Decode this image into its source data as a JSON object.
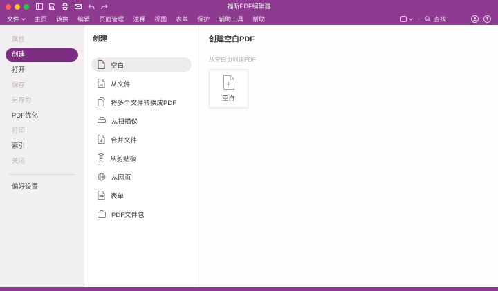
{
  "colors": {
    "titlebar": "#8e3a91",
    "accent": "#7d2d82",
    "sidebar_bg": "#f1eff1",
    "selected_pill": "#ececec"
  },
  "titlebar": {
    "title": "福昕PDF编辑器"
  },
  "menubar": {
    "items": [
      {
        "label": "文件",
        "state": "active-with-caret"
      },
      {
        "label": "主页"
      },
      {
        "label": "转换"
      },
      {
        "label": "编辑"
      },
      {
        "label": "页面管理"
      },
      {
        "label": "注释"
      },
      {
        "label": "视图"
      },
      {
        "label": "表单"
      },
      {
        "label": "保护"
      },
      {
        "label": "辅助工具"
      },
      {
        "label": "帮助"
      }
    ],
    "search_label": "查找",
    "separator": "·"
  },
  "sidebar": {
    "items": [
      {
        "label": "属性",
        "state": "disabled"
      },
      {
        "label": "创建",
        "state": "selected"
      },
      {
        "label": "打开",
        "state": "normal"
      },
      {
        "label": "保存",
        "state": "disabled"
      },
      {
        "label": "另存为",
        "state": "disabled"
      },
      {
        "label": "PDF优化",
        "state": "normal"
      },
      {
        "label": "打印",
        "state": "disabled"
      },
      {
        "label": "索引",
        "state": "normal"
      },
      {
        "label": "关闭",
        "state": "disabled"
      }
    ],
    "footer_item": {
      "label": "偏好设置"
    }
  },
  "create_panel": {
    "title": "创建",
    "items": [
      {
        "label": "空白",
        "selected": true
      },
      {
        "label": "从文件"
      },
      {
        "label": "将多个文件转换成PDF"
      },
      {
        "label": "从扫描仪"
      },
      {
        "label": "合并文件"
      },
      {
        "label": "从剪贴板"
      },
      {
        "label": "从网页"
      },
      {
        "label": "表单"
      },
      {
        "label": "PDF文件包"
      }
    ]
  },
  "content": {
    "title": "创建空白PDF",
    "subtitle": "从空白页创建PDF",
    "card": {
      "label": "空白"
    }
  }
}
